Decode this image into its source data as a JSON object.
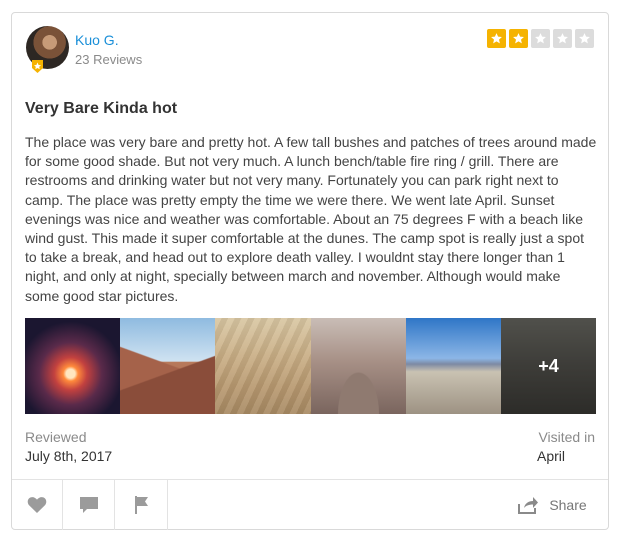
{
  "reviewer": {
    "name": "Kuo G.",
    "review_count": "23 Reviews"
  },
  "rating": {
    "value": 2,
    "max": 5,
    "filled_color": "#f5b301",
    "empty_color": "#dcdcdc"
  },
  "review": {
    "title": "Very Bare Kinda hot",
    "body": "The place was very bare and pretty hot. A few tall bushes and patches of trees around made for some good shade. But not very much. A lunch bench/table fire ring / grill. There are restrooms and drinking water but not very many. Fortunately you can park right next to camp. The place was pretty empty the time we were there. We went late April. Sunset evenings was nice and weather was comfortable. About an 75 degrees F with a beach like wind gust. This made it super comfortable at the dunes. The camp spot is really just a spot to take a break, and head out to explore death valley. I wouldnt stay there longer than 1 night, and only at night, specially between march and november. Although would make some good star pictures."
  },
  "photos": {
    "more_label": "+4",
    "items": [
      {
        "name": "campfire"
      },
      {
        "name": "canyon-hike"
      },
      {
        "name": "badlands-hike"
      },
      {
        "name": "dune-feet"
      },
      {
        "name": "salt-flat-group"
      },
      {
        "name": "camp-gathering"
      }
    ]
  },
  "meta": {
    "reviewed_label": "Reviewed",
    "reviewed_date": "July 8th, 2017",
    "visited_label": "Visited in",
    "visited_month": "April"
  },
  "actions": {
    "share_label": "Share"
  },
  "colors": {
    "link": "#1a8fd8",
    "icon_gray": "#9b9b9b"
  }
}
